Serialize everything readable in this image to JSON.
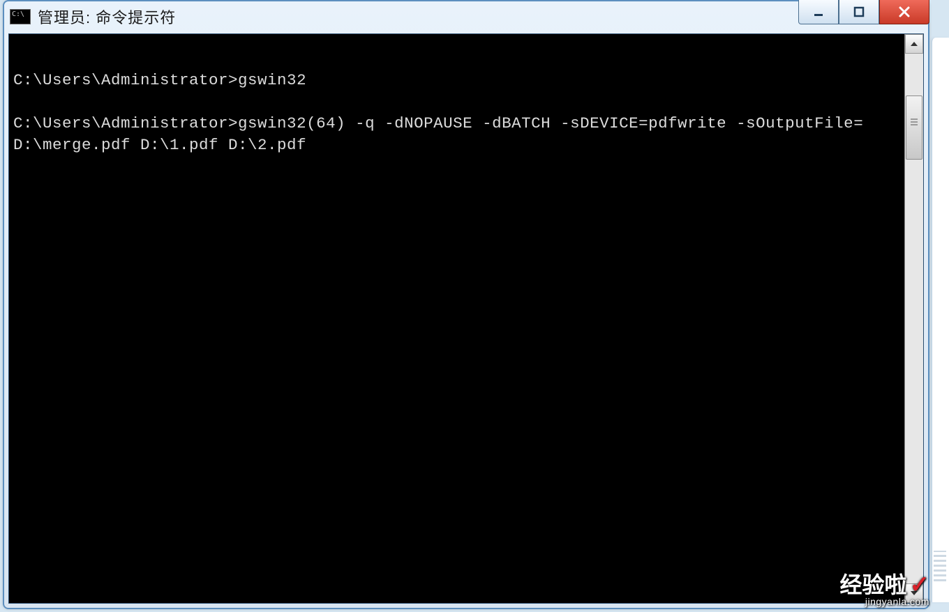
{
  "window": {
    "title": "管理员: 命令提示符"
  },
  "terminal": {
    "lines": [
      "C:\\Users\\Administrator>gswin32",
      "",
      "C:\\Users\\Administrator>gswin32(64) -q -dNOPAUSE -dBATCH -sDEVICE=pdfwrite -sOutputFile=D:\\merge.pdf D:\\1.pdf D:\\2.pdf"
    ]
  },
  "watermark": {
    "main": "经验啦",
    "check": "✓",
    "sub": "jingyanla.com"
  }
}
